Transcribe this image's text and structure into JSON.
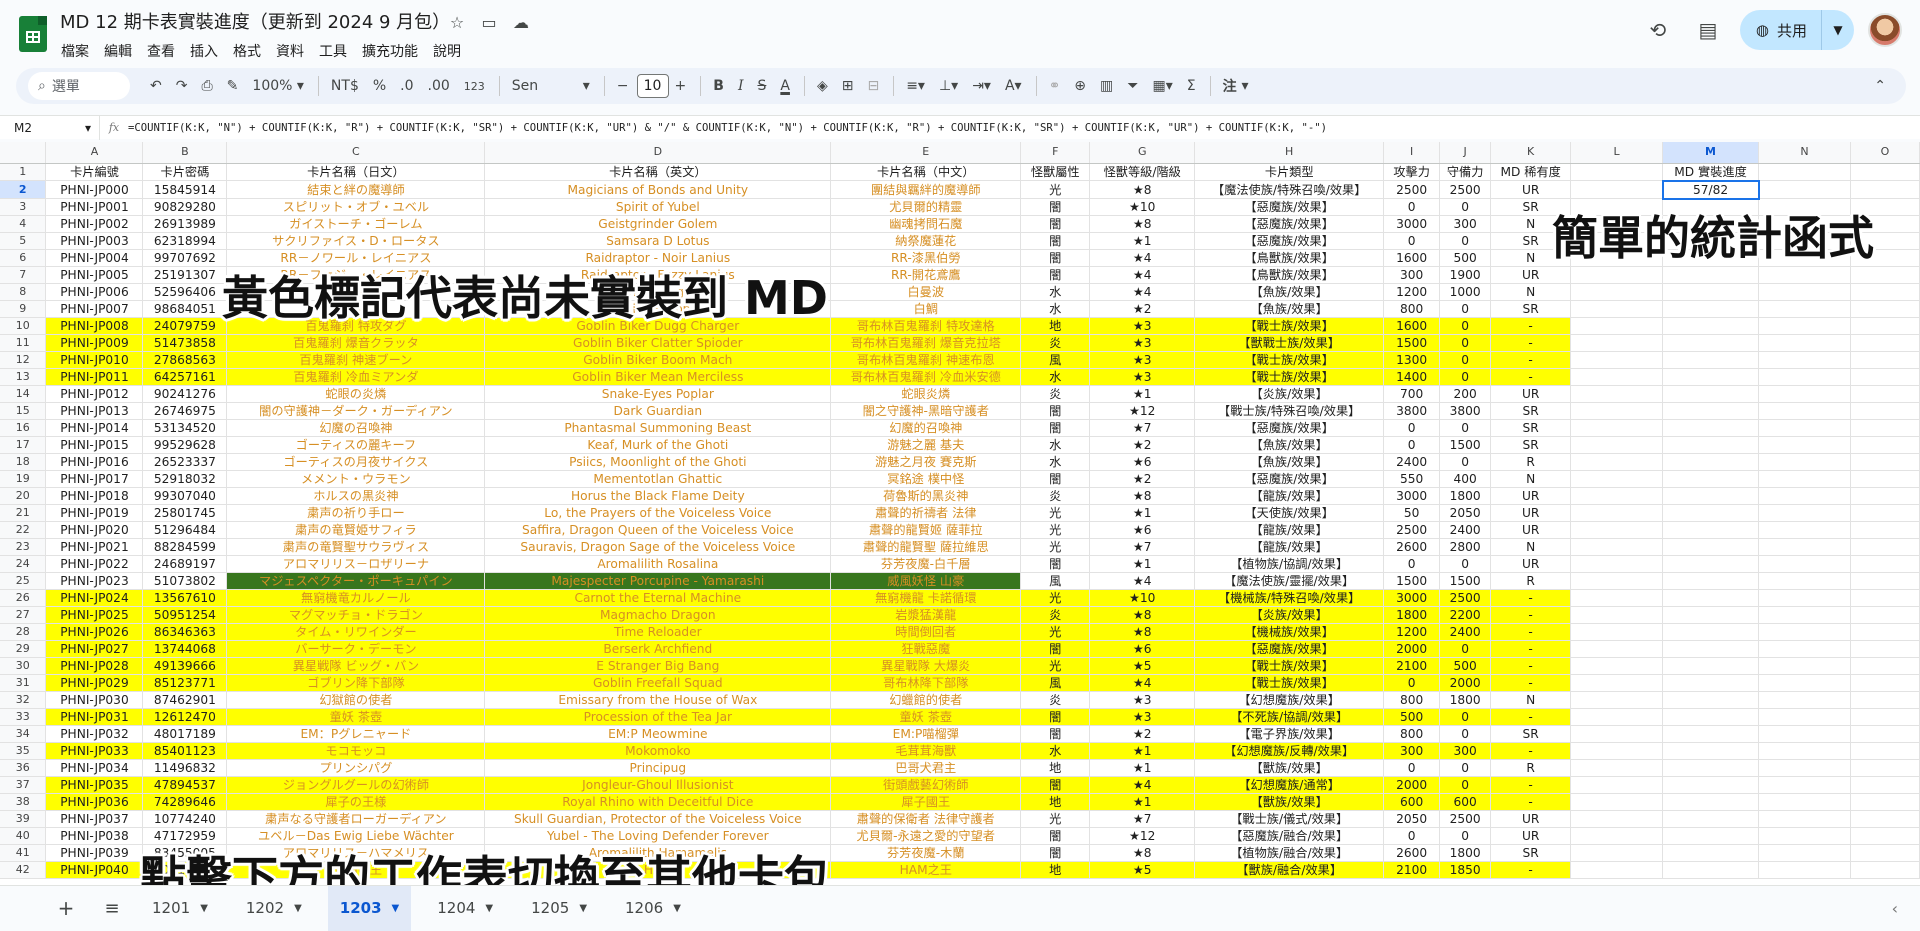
{
  "app": {
    "doc_title": "MD 12 期卡表實裝進度（更新到 2024 9 月包）",
    "menu": [
      "檔案",
      "編輯",
      "查看",
      "插入",
      "格式",
      "資料",
      "工具",
      "擴充功能",
      "說明"
    ],
    "share_label": "共用"
  },
  "toolbar": {
    "search_placeholder": "選單",
    "zoom": "100%",
    "currency": "NT$",
    "percent": "%",
    "dec_decrease": ".0",
    "dec_increase": ".00",
    "number_format": "123",
    "font": "Sen",
    "font_size": "10",
    "bold": "B",
    "italic": "I",
    "strike": "S",
    "text_color": "A",
    "notes": "注"
  },
  "formula_bar": {
    "name_box": "M2",
    "fx": "fx",
    "formula": "=COUNTIF(K:K, \"N\") + COUNTIF(K:K, \"R\") + COUNTIF(K:K, \"SR\") + COUNTIF(K:K, \"UR\") & \"/\" & COUNTIF(K:K, \"N\") + COUNTIF(K:K, \"R\") + COUNTIF(K:K, \"SR\") + COUNTIF(K:K, \"UR\") + COUNTIF(K:K, \"-\")"
  },
  "columns": [
    "A",
    "B",
    "C",
    "D",
    "E",
    "F",
    "G",
    "H",
    "I",
    "J",
    "K",
    "L",
    "M",
    "N",
    "O"
  ],
  "header_row": [
    "卡片編號",
    "卡片密碼",
    "卡片名稱（日文）",
    "卡片名稱（英文）",
    "卡片名稱（中文）",
    "怪獸屬性",
    "怪獸等級/階級",
    "卡片類型",
    "攻擊力",
    "守備力",
    "MD 稀有度",
    "",
    "MD 實裝進度",
    "",
    ""
  ],
  "m2_value": "57/82",
  "rows": [
    {
      "n": "2",
      "hl": "",
      "c": [
        "PHNI-JP000",
        "15845914",
        "結束と絆の魔導師",
        "Magicians of Bonds and Unity",
        "團結與羈絆的魔導師",
        "光",
        "★8",
        "【魔法使族/特殊召喚/效果】",
        "2500",
        "2500",
        "UR"
      ]
    },
    {
      "n": "3",
      "hl": "",
      "c": [
        "PHNI-JP001",
        "90829280",
        "スピリット・オブ・ユベル",
        "Spirit of Yubel",
        "尤貝爾的精靈",
        "闇",
        "★10",
        "【惡魔族/效果】",
        "0",
        "0",
        "SR"
      ]
    },
    {
      "n": "4",
      "hl": "",
      "c": [
        "PHNI-JP002",
        "26913989",
        "ガイストーチ・ゴーレム",
        "Geistgrinder Golem",
        "幽魂拷問石魔",
        "闇",
        "★8",
        "【惡魔族/效果】",
        "3000",
        "300",
        "N"
      ]
    },
    {
      "n": "5",
      "hl": "",
      "c": [
        "PHNI-JP003",
        "62318994",
        "サクリファイス・D・ロータス",
        "Samsara D Lotus",
        "納祭魔蓮花",
        "闇",
        "★1",
        "【惡魔族/效果】",
        "0",
        "0",
        "SR"
      ]
    },
    {
      "n": "6",
      "hl": "",
      "c": [
        "PHNI-JP004",
        "99707692",
        "RR－ノワール・レイニアス",
        "Raidraptor - Noir Lanius",
        "RR-漆黑伯勞",
        "闇",
        "★4",
        "【鳥獸族/效果】",
        "1600",
        "500",
        "N"
      ]
    },
    {
      "n": "7",
      "hl": "",
      "c": [
        "PHNI-JP005",
        "25191307",
        "RR－ファジー・レイニアス",
        "Raidraptor - Fuzzy Lanius",
        "RR-開花鳶鷹",
        "闇",
        "★4",
        "【鳥獸族/效果】",
        "300",
        "1900",
        "UR"
      ]
    },
    {
      "n": "8",
      "hl": "",
      "c": [
        "PHNI-JP006",
        "52596406",
        "白の聖女",
        "White Angel",
        "白曼波",
        "水",
        "★4",
        "【魚族/效果】",
        "1200",
        "1000",
        "N"
      ]
    },
    {
      "n": "9",
      "hl": "",
      "c": [
        "PHNI-JP007",
        "98684051",
        "白鯛",
        "White Snapper",
        "白鯛",
        "水",
        "★2",
        "【魚族/效果】",
        "800",
        "0",
        "SR"
      ]
    },
    {
      "n": "10",
      "hl": "y",
      "c": [
        "PHNI-JP008",
        "24079759",
        "百鬼羅刹 特攻ダグ",
        "Goblin Biker Dugg Charger",
        "哥布林百鬼羅刹 特攻達格",
        "地",
        "★3",
        "【戰士族/效果】",
        "1600",
        "0",
        "-"
      ]
    },
    {
      "n": "11",
      "hl": "y",
      "c": [
        "PHNI-JP009",
        "51473858",
        "百鬼羅刹 爆音クラッタ",
        "Goblin Biker Clatter Spioder",
        "哥布林百鬼羅刹 爆音克拉塔",
        "炎",
        "★3",
        "【獸戰士族/效果】",
        "1500",
        "0",
        "-"
      ]
    },
    {
      "n": "12",
      "hl": "y",
      "c": [
        "PHNI-JP010",
        "27868563",
        "百鬼羅刹 神速ブーン",
        "Goblin Biker Boom Mach",
        "哥布林百鬼羅刹 神速布恩",
        "風",
        "★3",
        "【戰士族/效果】",
        "1300",
        "0",
        "-"
      ]
    },
    {
      "n": "13",
      "hl": "y",
      "c": [
        "PHNI-JP011",
        "64257161",
        "百鬼羅刹 冷血ミアンダ",
        "Goblin Biker Mean Merciless",
        "哥布林百鬼羅刹 冷血米安德",
        "水",
        "★3",
        "【戰士族/效果】",
        "1400",
        "0",
        "-"
      ]
    },
    {
      "n": "14",
      "hl": "",
      "c": [
        "PHNI-JP012",
        "90241276",
        "蛇眼の炎燐",
        "Snake-Eyes Poplar",
        "蛇眼炎燐",
        "炎",
        "★1",
        "【炎族/效果】",
        "700",
        "200",
        "UR"
      ]
    },
    {
      "n": "15",
      "hl": "",
      "c": [
        "PHNI-JP013",
        "26746975",
        "闇の守護神－ダーク・ガーディアン",
        "Dark Guardian",
        "闇之守護神-黑暗守護者",
        "闇",
        "★12",
        "【戰士族/特殊召喚/效果】",
        "3800",
        "3800",
        "SR"
      ]
    },
    {
      "n": "16",
      "hl": "",
      "c": [
        "PHNI-JP014",
        "53134520",
        "幻魔の召喚神",
        "Phantasmal Summoning Beast",
        "幻魔的召喚神",
        "闇",
        "★7",
        "【惡魔族/效果】",
        "0",
        "0",
        "SR"
      ]
    },
    {
      "n": "17",
      "hl": "",
      "c": [
        "PHNI-JP015",
        "99529628",
        "ゴーティスの麗キーフ",
        "Keaf, Murk of the Ghoti",
        "游魅之麗 基夫",
        "水",
        "★2",
        "【魚族/效果】",
        "0",
        "1500",
        "SR"
      ]
    },
    {
      "n": "18",
      "hl": "",
      "c": [
        "PHNI-JP016",
        "26523337",
        "ゴーティスの月夜サイクス",
        "Psiics, Moonlight of the Ghoti",
        "游魅之月夜 賽克斯",
        "水",
        "★6",
        "【魚族/效果】",
        "2400",
        "0",
        "R"
      ]
    },
    {
      "n": "19",
      "hl": "",
      "c": [
        "PHNI-JP017",
        "52918032",
        "メメント・ウラモン",
        "Mementotlan Ghattic",
        "冥銘途 樸中怪",
        "闇",
        "★2",
        "【惡魔族/效果】",
        "550",
        "400",
        "N"
      ]
    },
    {
      "n": "20",
      "hl": "",
      "c": [
        "PHNI-JP018",
        "99307040",
        "ホルスの黒炎神",
        "Horus the Black Flame Deity",
        "荷魯斯的黑炎神",
        "炎",
        "★8",
        "【龍族/效果】",
        "3000",
        "1800",
        "UR"
      ]
    },
    {
      "n": "21",
      "hl": "",
      "c": [
        "PHNI-JP019",
        "25801745",
        "粛声の祈り手ロー",
        "Lo, the Prayers of the Voiceless Voice",
        "肅聲的祈禱者 法律",
        "光",
        "★1",
        "【天使族/效果】",
        "50",
        "2050",
        "UR"
      ]
    },
    {
      "n": "22",
      "hl": "",
      "c": [
        "PHNI-JP020",
        "51296484",
        "粛声の竜賢姫サフィラ",
        "Saffira, Dragon Queen of the Voiceless Voice",
        "肅聲的龍賢姬 薩菲拉",
        "光",
        "★6",
        "【龍族/效果】",
        "2500",
        "2400",
        "UR"
      ]
    },
    {
      "n": "23",
      "hl": "",
      "c": [
        "PHNI-JP021",
        "88284599",
        "粛声の竜賢聖サウラヴィス",
        "Sauravis, Dragon Sage of the Voiceless Voice",
        "肅聲的龍賢聖 薩拉維思",
        "光",
        "★7",
        "【龍族/效果】",
        "2600",
        "2800",
        "N"
      ]
    },
    {
      "n": "24",
      "hl": "",
      "c": [
        "PHNI-JP022",
        "24689197",
        "アロマリリス－ロザリーナ",
        "Aromalilith Rosalina",
        "芬芳夜魔-白千層",
        "闇",
        "★1",
        "【植物族/協調/效果】",
        "0",
        "0",
        "UR"
      ]
    },
    {
      "n": "25",
      "hl": "g",
      "c": [
        "PHNI-JP023",
        "51073802",
        "マジェスペクター・ポーキュパイン",
        "Majespecter Porcupine - Yamarashi",
        "威風妖怪 山豪",
        "風",
        "★4",
        "【魔法使族/靈擺/效果】",
        "1500",
        "1500",
        "R"
      ]
    },
    {
      "n": "26",
      "hl": "y",
      "c": [
        "PHNI-JP024",
        "13567610",
        "無窮機竜カルノール",
        "Carnot the Eternal Machine",
        "無窮機龍 卡諾循環",
        "光",
        "★10",
        "【機械族/特殊召喚/效果】",
        "3000",
        "2500",
        "-"
      ]
    },
    {
      "n": "27",
      "hl": "y",
      "c": [
        "PHNI-JP025",
        "50951254",
        "マグマッチョ・ドラゴン",
        "Magmacho Dragon",
        "岩漿猛漢龍",
        "炎",
        "★8",
        "【炎族/效果】",
        "1800",
        "2200",
        "-"
      ]
    },
    {
      "n": "28",
      "hl": "y",
      "c": [
        "PHNI-JP026",
        "86346363",
        "タイム・リワインダー",
        "Time Reloader",
        "時間倒回者",
        "光",
        "★8",
        "【機械族/效果】",
        "1200",
        "2400",
        "-"
      ]
    },
    {
      "n": "29",
      "hl": "y",
      "c": [
        "PHNI-JP027",
        "13744068",
        "バーサーク・デーモン",
        "Berserk Archfiend",
        "狂戰惡魔",
        "闇",
        "★6",
        "【惡魔族/效果】",
        "2000",
        "0",
        "-"
      ]
    },
    {
      "n": "30",
      "hl": "y",
      "c": [
        "PHNI-JP028",
        "49139666",
        "異星戦隊 ビッグ・バン",
        "E Stranger Big Bang",
        "異星戰隊 大爆炎",
        "光",
        "★5",
        "【戰士族/效果】",
        "2100",
        "500",
        "-"
      ]
    },
    {
      "n": "31",
      "hl": "y",
      "c": [
        "PHNI-JP029",
        "85123771",
        "ゴブリン降下部隊",
        "Goblin Freefall Squad",
        "哥布林降下部隊",
        "風",
        "★4",
        "【戰士族/效果】",
        "0",
        "2000",
        "-"
      ]
    },
    {
      "n": "32",
      "hl": "",
      "c": [
        "PHNI-JP030",
        "87462901",
        "幻獄館の使者",
        "Emissary from the House of Wax",
        "幻蠟館的使者",
        "炎",
        "★3",
        "【幻想魔族/效果】",
        "800",
        "1800",
        "N"
      ]
    },
    {
      "n": "33",
      "hl": "y",
      "c": [
        "PHNI-JP031",
        "12612470",
        "童妖 茶壺",
        "Procession of the Tea Jar",
        "童妖 茶壺",
        "闇",
        "★3",
        "【不死族/協調/效果】",
        "500",
        "0",
        "-"
      ]
    },
    {
      "n": "34",
      "hl": "",
      "c": [
        "PHNI-JP032",
        "48017189",
        "EM：Pグレニャード",
        "EM:P Meowmine",
        "EM:P喵榴彈",
        "闇",
        "★2",
        "【電子界族/效果】",
        "800",
        "0",
        "SR"
      ]
    },
    {
      "n": "35",
      "hl": "y",
      "c": [
        "PHNI-JP033",
        "85401123",
        "モコモッコ",
        "Mokomoko",
        "毛茸茸海獸",
        "水",
        "★1",
        "【幻想魔族/反轉/效果】",
        "300",
        "300",
        "-"
      ]
    },
    {
      "n": "36",
      "hl": "",
      "c": [
        "PHNI-JP034",
        "11496832",
        "プリンシパグ",
        "Principug",
        "巴哥犬君主",
        "地",
        "★1",
        "【獸族/效果】",
        "0",
        "0",
        "R"
      ]
    },
    {
      "n": "37",
      "hl": "y",
      "c": [
        "PHNI-JP035",
        "47894537",
        "ジョングルグールの幻術師",
        "Jongleur-Ghoul Illusionist",
        "街頭戲藝幻術師",
        "闇",
        "★4",
        "【幻想魔族/通常】",
        "2000",
        "0",
        "-"
      ]
    },
    {
      "n": "38",
      "hl": "y",
      "c": [
        "PHNI-JP036",
        "74289646",
        "犀子の王様",
        "Royal Rhino with Deceitful Dice",
        "犀子國王",
        "地",
        "★1",
        "【獸族/效果】",
        "600",
        "600",
        "-"
      ]
    },
    {
      "n": "39",
      "hl": "",
      "c": [
        "PHNI-JP037",
        "10774240",
        "粛声なる守護者ローガーディアン",
        "Skull Guardian, Protector of the Voiceless Voice",
        "肅聲的保衛者 法律守護者",
        "光",
        "★7",
        "【戰士族/儀式/效果】",
        "2050",
        "2500",
        "UR"
      ]
    },
    {
      "n": "40",
      "hl": "",
      "c": [
        "PHNI-JP038",
        "47172959",
        "ユベル－Das Ewig Liebe Wächter",
        "Yubel - The Loving Defender Forever",
        "尤貝爾-永遠之愛的守望者",
        "闇",
        "★12",
        "【惡魔族/融合/效果】",
        "0",
        "0",
        "UR"
      ]
    },
    {
      "n": "41",
      "hl": "",
      "c": [
        "PHNI-JP039",
        "83455005",
        "アロマリリス－ハマメリス",
        "Aromalilith Hamamelis",
        "芬芳夜魔-木蘭",
        "闇",
        "★8",
        "【植物族/融合/效果】",
        "2600",
        "1800",
        "SR"
      ]
    },
    {
      "n": "42",
      "hl": "y",
      "c": [
        "PHNI-JP040",
        "10112348",
        "HAMの王",
        "HAM",
        "HAM之王",
        "地",
        "★5",
        "【獸族/融合/效果】",
        "2100",
        "1850",
        "-"
      ]
    }
  ],
  "overlays": {
    "yellow_note": "黃色標記代表尚未實裝到 MD",
    "stats_note": "簡單的統計函式",
    "sheet_note": "點擊下方的工作表切換至其他卡包"
  },
  "sheets": [
    "1201",
    "1202",
    "1203",
    "1204",
    "1205",
    "1206"
  ],
  "active_sheet": "1203",
  "colors": {
    "highlight_yellow": "#ffff00",
    "highlight_green": "#38761d",
    "name_text": "#d68f24",
    "sheets_green": "#188038",
    "share_bg": "#c2e7ff"
  }
}
